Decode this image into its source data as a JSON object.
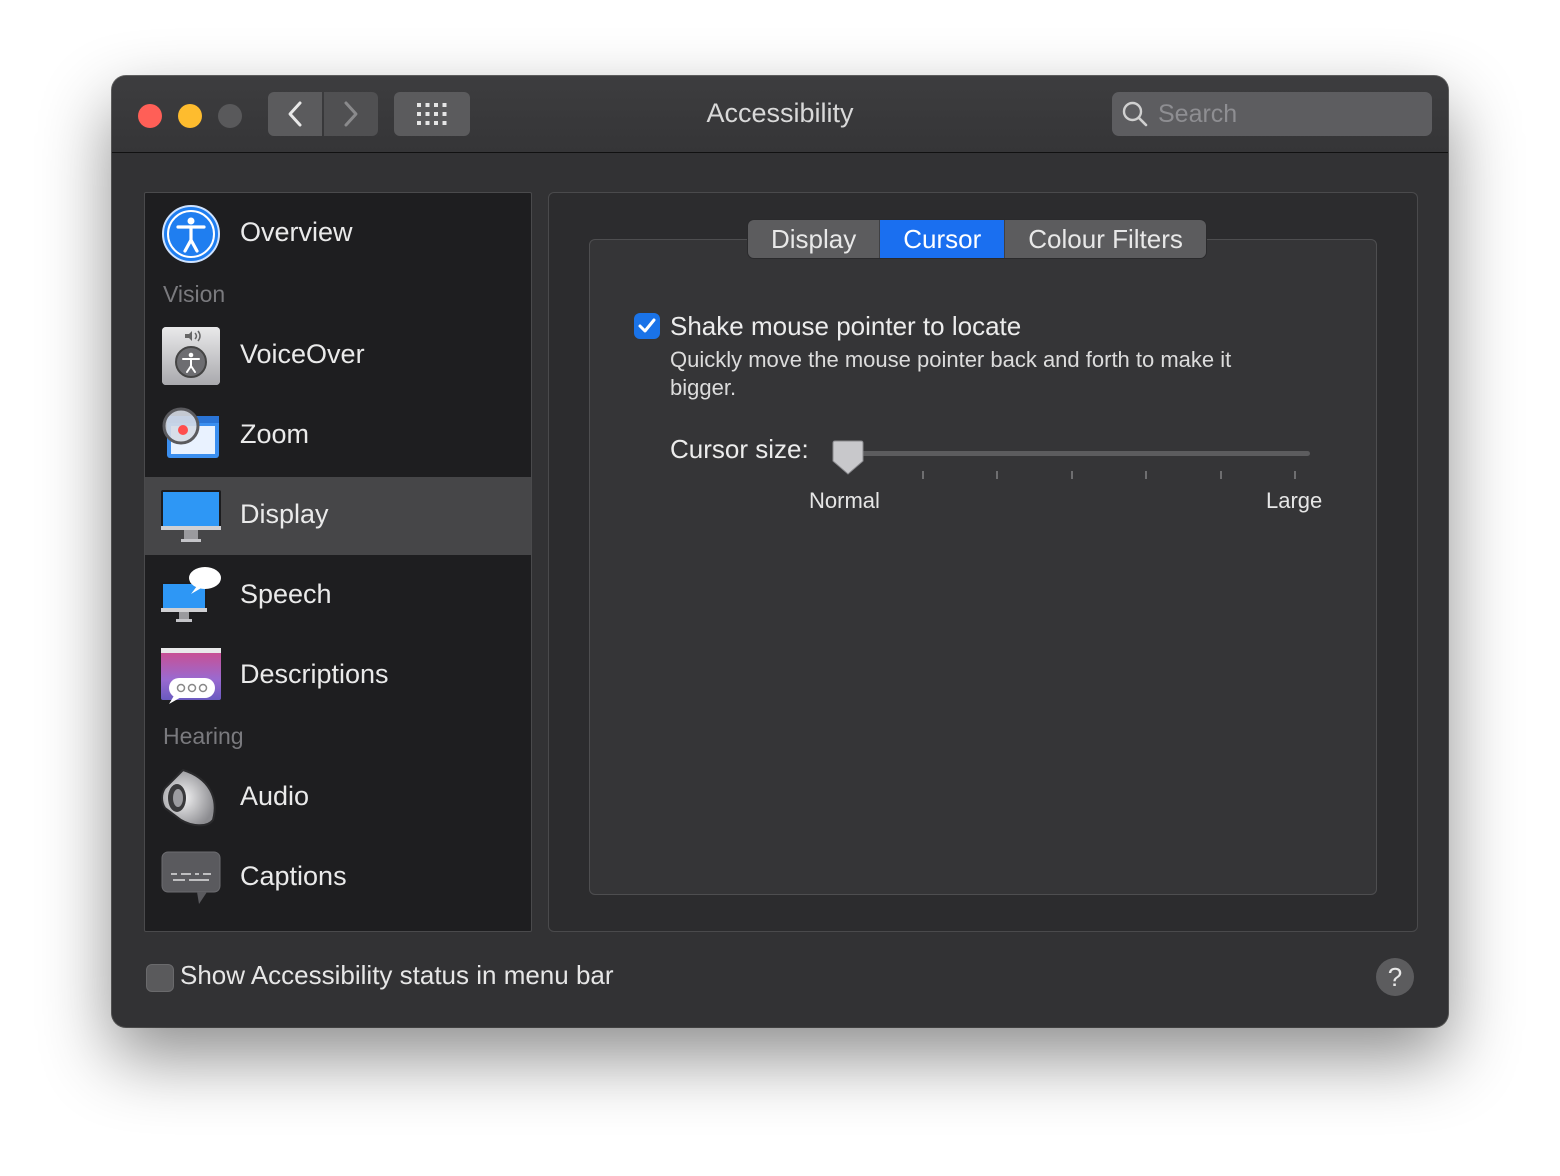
{
  "window": {
    "title": "Accessibility"
  },
  "search": {
    "placeholder": "Search"
  },
  "sidebar": {
    "items": [
      {
        "label": "Overview",
        "icon": "accessibility-icon"
      },
      {
        "section": "Vision"
      },
      {
        "label": "VoiceOver",
        "icon": "voiceover-icon"
      },
      {
        "label": "Zoom",
        "icon": "zoom-icon"
      },
      {
        "label": "Display",
        "icon": "display-icon",
        "selected": true
      },
      {
        "label": "Speech",
        "icon": "speech-icon"
      },
      {
        "label": "Descriptions",
        "icon": "descriptions-icon"
      },
      {
        "section": "Hearing"
      },
      {
        "label": "Audio",
        "icon": "speaker-icon"
      },
      {
        "label": "Captions",
        "icon": "captions-icon"
      }
    ]
  },
  "tabs": [
    {
      "label": "Display",
      "active": false
    },
    {
      "label": "Cursor",
      "active": true
    },
    {
      "label": "Colour Filters",
      "active": false
    }
  ],
  "cursor_tab": {
    "shake": {
      "checked": true,
      "label": "Shake mouse pointer to locate",
      "description": "Quickly move the mouse pointer back and forth to make it bigger."
    },
    "cursor_size": {
      "label": "Cursor size:",
      "min_label": "Normal",
      "max_label": "Large",
      "value": 0.0
    }
  },
  "footer": {
    "status_checkbox_checked": false,
    "status_label": "Show Accessibility status in menu bar",
    "help_label": "?"
  },
  "colors": {
    "accent": "#1a6ff0",
    "selected_row": "#464648"
  }
}
